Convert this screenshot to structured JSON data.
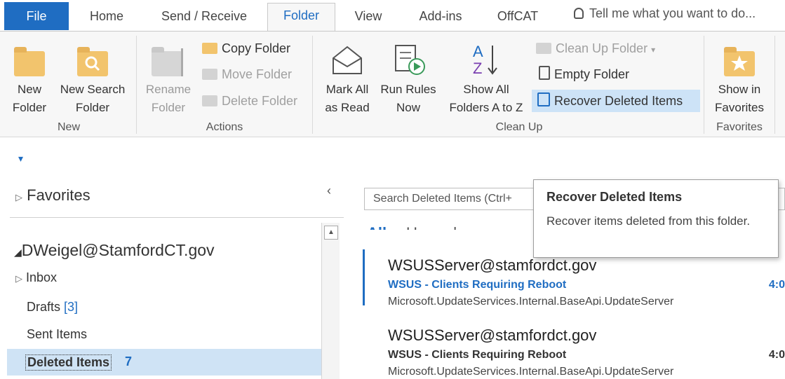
{
  "tabs": {
    "file": "File",
    "home": "Home",
    "send_receive": "Send / Receive",
    "folder": "Folder",
    "view": "View",
    "addins": "Add-ins",
    "offcat": "OffCAT",
    "tell_me": "Tell me what you want to do..."
  },
  "ribbon": {
    "new_folder": [
      "New",
      "Folder"
    ],
    "new_search_folder": [
      "New Search",
      "Folder"
    ],
    "rename_folder": [
      "Rename",
      "Folder"
    ],
    "copy_folder": "Copy Folder",
    "move_folder": "Move Folder",
    "delete_folder": "Delete Folder",
    "mark_all_read": [
      "Mark All",
      "as Read"
    ],
    "run_rules": [
      "Run Rules",
      "Now"
    ],
    "show_all_folders": [
      "Show All",
      "Folders A to Z"
    ],
    "clean_up_folder": "Clean Up Folder",
    "empty_folder": "Empty Folder",
    "recover_deleted": "Recover Deleted Items",
    "show_in_favorites": [
      "Show in",
      "Favorites"
    ],
    "groups": {
      "new": "New",
      "actions": "Actions",
      "clean_up": "Clean Up",
      "favorites": "Favorites"
    }
  },
  "nav": {
    "favorites": "Favorites",
    "account": "DWeigel@StamfordCT.gov",
    "inbox": "Inbox",
    "drafts": "Drafts",
    "drafts_count": "[3]",
    "sent": "Sent Items",
    "deleted": "Deleted Items",
    "deleted_count": "7"
  },
  "list": {
    "search_placeholder": "Search Deleted Items (Ctrl+",
    "filter_all": "All",
    "filter_unread": "Unread",
    "mails": [
      {
        "from": "WSUSServer@stamfordct.gov",
        "subject": "WSUS - Clients Requiring Reboot",
        "preview": "Microsoft.UpdateServices.Internal.BaseApi.UpdateServer",
        "time": "4:0"
      },
      {
        "from": "WSUSServer@stamfordct.gov",
        "subject": "WSUS - Clients Requiring Reboot",
        "preview": "Microsoft.UpdateServices.Internal.BaseApi.UpdateServer",
        "time": "4:0"
      }
    ]
  },
  "tooltip": {
    "title": "Recover Deleted Items",
    "body": "Recover items deleted from this folder."
  },
  "colors": {
    "accent": "#1f6dc2",
    "folder_yellow": "#f2c46d",
    "selection": "#cde3f7",
    "nav_selected": "#cfe3f5"
  }
}
